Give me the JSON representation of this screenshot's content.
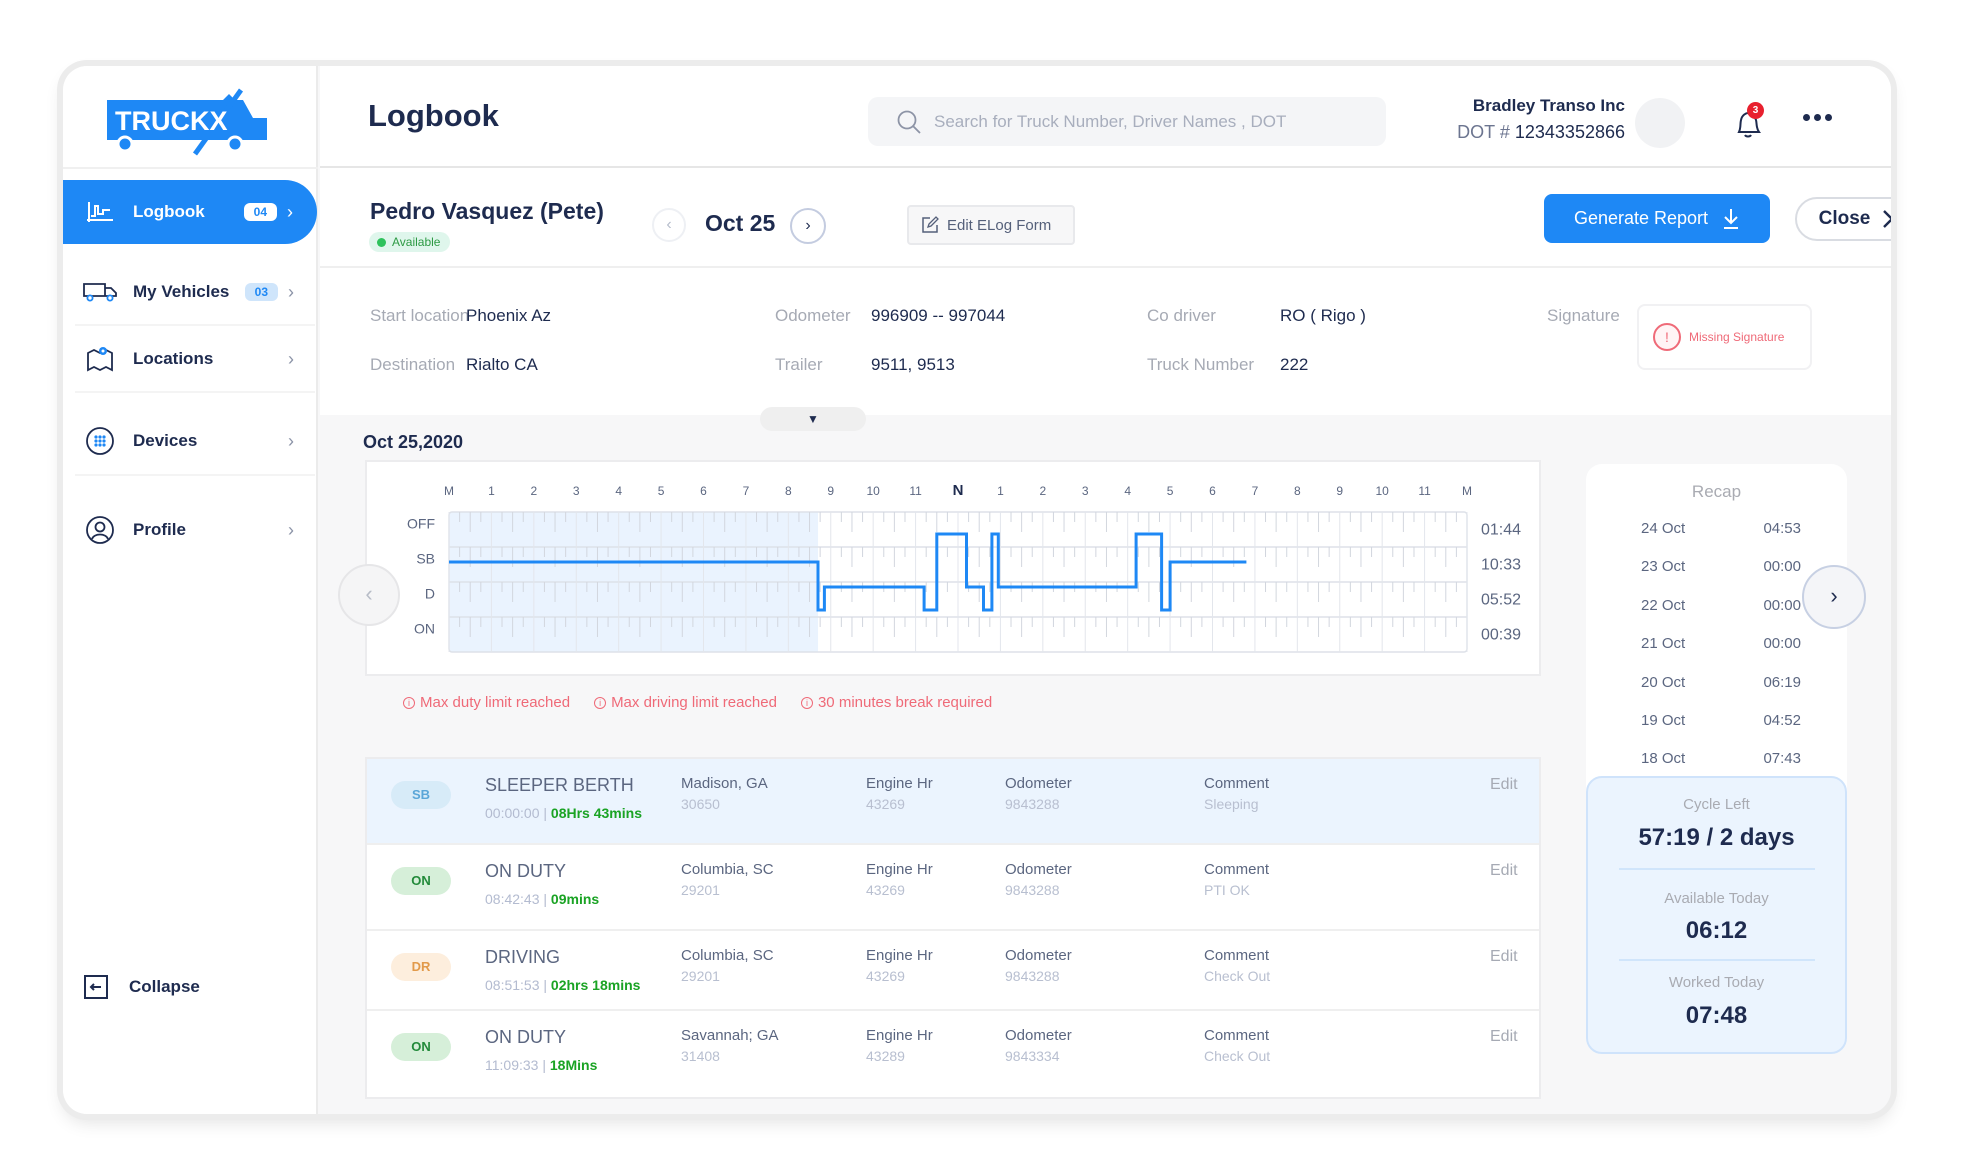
{
  "app": {
    "brand": "TRUCKX",
    "page_title": "Logbook"
  },
  "sidebar": {
    "items": [
      {
        "label": "Logbook",
        "badge": "04",
        "active": true,
        "icon": "logbook-chart-icon"
      },
      {
        "label": "My Vehicles",
        "badge": "03",
        "active": false,
        "icon": "truck-icon"
      },
      {
        "label": "Locations",
        "badge": null,
        "active": false,
        "icon": "map-pin-icon"
      },
      {
        "label": "Devices",
        "badge": null,
        "active": false,
        "icon": "device-icon"
      },
      {
        "label": "Profile",
        "badge": null,
        "active": false,
        "icon": "user-icon"
      }
    ],
    "collapse_label": "Collapse"
  },
  "header": {
    "search_placeholder": "Search for Truck Number, Driver Names , DOT",
    "company_name": "Bradley Transo Inc",
    "dot_label": "DOT #",
    "dot_number": "12343352866",
    "notification_count": "3"
  },
  "driver": {
    "name": "Pedro Vasquez (Pete)",
    "status": "Available",
    "date": "Oct 25",
    "edit_form_label": "Edit ELog Form",
    "generate_report_label": "Generate Report",
    "close_label": "Close"
  },
  "info": {
    "start_location_label": "Start location",
    "start_location": "Phoenix Az",
    "destination_label": "Destination",
    "destination": "Rialto CA",
    "odometer_label": "Odometer",
    "odometer": "996909 -- 997044",
    "trailer_label": "Trailer",
    "trailer": "9511, 9513",
    "co_driver_label": "Co driver",
    "co_driver": "RO ( Rigo )",
    "truck_number_label": "Truck Number",
    "truck_number": "222",
    "signature_label": "Signature",
    "signature_status": "Missing Signature"
  },
  "section_date": "Oct 25,2020",
  "chart_data": {
    "type": "line",
    "title": "Oct 25,2020",
    "x_tick_labels": [
      "M",
      "1",
      "2",
      "3",
      "4",
      "5",
      "6",
      "7",
      "8",
      "9",
      "10",
      "11",
      "N",
      "1",
      "2",
      "3",
      "4",
      "5",
      "6",
      "7",
      "8",
      "9",
      "10",
      "11",
      "M"
    ],
    "x_range_hours": [
      0,
      24
    ],
    "rows": [
      "OFF",
      "SB",
      "D",
      "ON"
    ],
    "row_totals": [
      "01:44",
      "10:33",
      "05:52",
      "00:39"
    ],
    "highlight_until_hour": 8.7,
    "segments": [
      {
        "status": "SB",
        "start": 0,
        "end": 8.7
      },
      {
        "status": "ON",
        "start": 8.7,
        "end": 8.85
      },
      {
        "status": "D",
        "start": 8.85,
        "end": 11.2
      },
      {
        "status": "ON",
        "start": 11.2,
        "end": 11.5
      },
      {
        "status": "OFF",
        "start": 11.5,
        "end": 12.2
      },
      {
        "status": "D",
        "start": 12.2,
        "end": 12.6
      },
      {
        "status": "ON",
        "start": 12.6,
        "end": 12.8
      },
      {
        "status": "OFF",
        "start": 12.8,
        "end": 12.95
      },
      {
        "status": "D",
        "start": 12.95,
        "end": 16.2
      },
      {
        "status": "OFF",
        "start": 16.2,
        "end": 16.8
      },
      {
        "status": "ON",
        "start": 16.8,
        "end": 17.0
      },
      {
        "status": "SB",
        "start": 17.0,
        "end": 18.8
      }
    ]
  },
  "warnings": [
    "Max duty limit reached",
    "Max driving limit reached",
    "30 minutes break required"
  ],
  "logs": [
    {
      "badge": "SB",
      "badge_type": "sb",
      "status": "SLEEPER BERTH",
      "time": "00:00:00",
      "duration": "08Hrs 43mins",
      "location": "Madison, GA",
      "zip": "30650",
      "engine_label": "Engine Hr",
      "engine": "43269",
      "odometer_label": "Odometer",
      "odometer": "9843288",
      "comment_label": "Comment",
      "comment": "Sleeping",
      "edit": "Edit",
      "selected": true
    },
    {
      "badge": "ON",
      "badge_type": "on",
      "status": "ON DUTY",
      "time": "08:42:43",
      "duration": "09mins",
      "location": "Columbia, SC",
      "zip": "29201",
      "engine_label": "Engine Hr",
      "engine": "43269",
      "odometer_label": "Odometer",
      "odometer": "9843288",
      "comment_label": "Comment",
      "comment": "PTI OK",
      "edit": "Edit",
      "selected": false
    },
    {
      "badge": "DR",
      "badge_type": "dr",
      "status": "DRIVING",
      "time": "08:51:53",
      "duration": "02hrs 18mins",
      "location": "Columbia, SC",
      "zip": "29201",
      "engine_label": "Engine Hr",
      "engine": "43269",
      "odometer_label": "Odometer",
      "odometer": "9843288",
      "comment_label": "Comment",
      "comment": "Check Out",
      "edit": "Edit",
      "selected": false
    },
    {
      "badge": "ON",
      "badge_type": "on",
      "status": "ON DUTY",
      "time": "11:09:33",
      "duration": "18Mins",
      "location": "Savannah; GA",
      "zip": "31408",
      "engine_label": "Engine Hr",
      "engine": "43289",
      "odometer_label": "Odometer",
      "odometer": "9843334",
      "comment_label": "Comment",
      "comment": "Check Out",
      "edit": "Edit",
      "selected": false
    }
  ],
  "recap": {
    "title": "Recap",
    "rows": [
      {
        "date": "24 Oct",
        "hours": "04:53"
      },
      {
        "date": "23 Oct",
        "hours": "00:00"
      },
      {
        "date": "22 Oct",
        "hours": "00:00"
      },
      {
        "date": "21 Oct",
        "hours": "00:00"
      },
      {
        "date": "20 Oct",
        "hours": "06:19"
      },
      {
        "date": "19 Oct",
        "hours": "04:52"
      },
      {
        "date": "18 Oct",
        "hours": "07:43"
      }
    ],
    "cycle_left_label": "Cycle Left",
    "cycle_left": "57:19 / 2 days",
    "available_today_label": "Available Today",
    "available_today": "06:12",
    "worked_today_label": "Worked Today",
    "worked_today": "07:48"
  },
  "colors": {
    "accent": "#1e88f5",
    "text": "#1e2b4f",
    "warning": "#ef6a78",
    "success": "#1aa324"
  }
}
